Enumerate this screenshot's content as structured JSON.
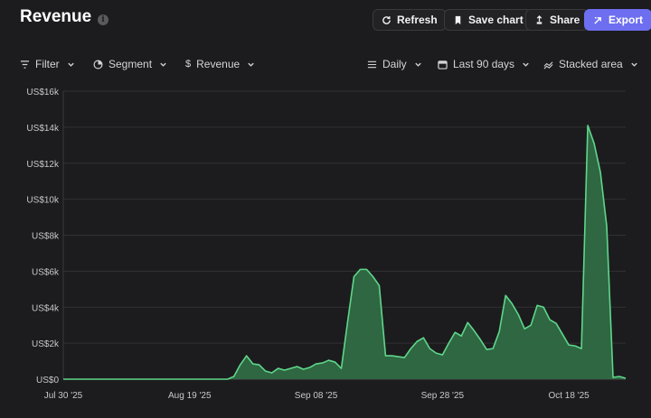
{
  "header": {
    "title": "Revenue",
    "info_icon": "info-icon",
    "buttons": {
      "refresh": "Refresh",
      "save_chart": "Save chart",
      "share": "Share",
      "export": "Export"
    }
  },
  "toolbar": {
    "filter": "Filter",
    "segment": "Segment",
    "metric": "Revenue",
    "interval": "Daily",
    "range": "Last 90 days",
    "chart_type": "Stacked area"
  },
  "colors": {
    "background": "#1c1c1e",
    "accent": "#6d6ef0",
    "area_fill": "#2f6b45",
    "area_line": "#5fd68a"
  },
  "chart_data": {
    "type": "area",
    "ylim": [
      0,
      16000
    ],
    "y_ticks": [
      0,
      2000,
      4000,
      6000,
      8000,
      10000,
      12000,
      14000,
      16000
    ],
    "y_tick_labels": [
      "US$0",
      "US$2k",
      "US$4k",
      "US$6k",
      "US$8k",
      "US$10k",
      "US$12k",
      "US$14k",
      "US$16k"
    ],
    "x_tick_labels": [
      "Jul 30 '25",
      "Aug 19 '25",
      "Sep 08 '25",
      "Sep 28 '25",
      "Oct 18 '25"
    ],
    "x_tick_days": [
      0,
      20,
      40,
      60,
      80
    ],
    "grid": true,
    "series": [
      {
        "values": [
          0,
          0,
          0,
          0,
          0,
          0,
          0,
          0,
          0,
          0,
          0,
          0,
          0,
          0,
          0,
          0,
          0,
          0,
          0,
          0,
          0,
          0,
          0,
          0,
          0,
          0,
          0,
          150,
          800,
          1300,
          850,
          800,
          450,
          350,
          600,
          500,
          600,
          700,
          550,
          650,
          850,
          900,
          1050,
          950,
          600,
          3200,
          5700,
          6100,
          6100,
          5700,
          5200,
          1300,
          1300,
          1250,
          1200,
          1700,
          2100,
          2300,
          1700,
          1450,
          1350,
          2000,
          2600,
          2400,
          3150,
          2700,
          2200,
          1650,
          1700,
          2650,
          4650,
          4200,
          3600,
          2800,
          3000,
          4100,
          4000,
          3300,
          3100,
          2500,
          1900,
          1850,
          1700,
          14100,
          13100,
          11500,
          8500,
          100,
          150,
          50
        ]
      }
    ]
  }
}
